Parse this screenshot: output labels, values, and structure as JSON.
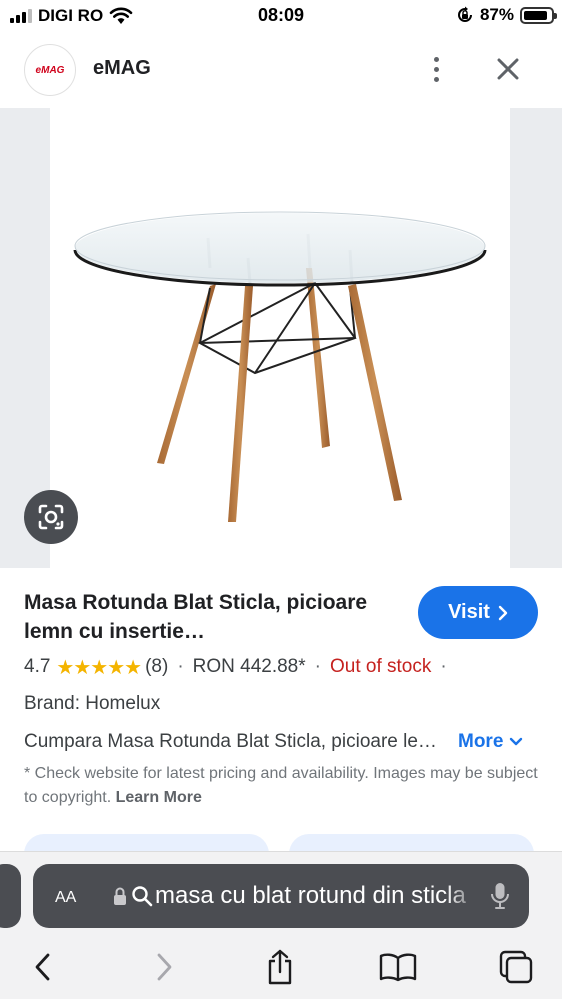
{
  "status_bar": {
    "carrier": "DIGI RO",
    "time": "08:09",
    "battery_percent": "87%",
    "battery_level": 0.87,
    "signal_bars_active": 3,
    "icons": [
      "signal-icon",
      "wifi-icon",
      "orientation-lock-icon",
      "battery-icon"
    ]
  },
  "site": {
    "logo_text": "eMAG",
    "name": "eMAG",
    "icons": [
      "more-vertical-icon",
      "close-icon"
    ]
  },
  "image": {
    "alt": "glass round table with wooden legs",
    "lens_icon": "google-lens-icon"
  },
  "product": {
    "title": "Masa Rotunda Blat Sticla, picioare lemn cu insertie…",
    "visit_label": "Visit",
    "rating": "4.7",
    "stars": "★★★★★",
    "review_count": "(8)",
    "separator": "·",
    "price": "RON 442.88*",
    "stock_status": "Out of stock",
    "brand": "Brand: Homelux",
    "description": "Cumpara Masa Rotunda Blat Sticla, picioare lemn cu insertie…",
    "more_label": "More",
    "disclaimer": "* Check website for latest pricing and availability. Images may be subject to copyright.",
    "learn_more": "Learn More"
  },
  "browser": {
    "aa_label": "AA",
    "url_text": "masa cu blat rotund din sticla",
    "toolbar_icons": [
      "back-icon",
      "forward-icon",
      "share-icon",
      "bookmarks-icon",
      "tabs-icon"
    ]
  },
  "colors": {
    "accent": "#1a73e8",
    "out_of_stock": "#c5221f",
    "stars": "#f4b400",
    "chrome_bar": "#4b4d52"
  }
}
